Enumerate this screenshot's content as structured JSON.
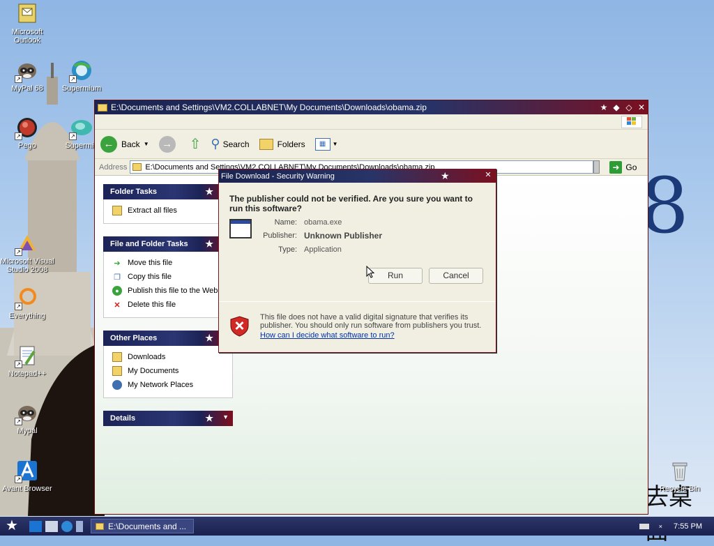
{
  "desktop": {
    "icons": [
      {
        "label": "Microsoft\nOutlook",
        "icon": "outlook-icon"
      },
      {
        "label": "MyPal 68",
        "icon": "raccoon-icon"
      },
      {
        "label": "Supermium",
        "icon": "supermium-icon"
      },
      {
        "label": "Pego",
        "icon": "pego-icon"
      },
      {
        "label": "Supermiu",
        "icon": "supermium-icon"
      },
      {
        "label": "Microsoft Visual Studio 2008",
        "icon": "visual-studio-icon"
      },
      {
        "label": "Everything",
        "icon": "everything-icon"
      },
      {
        "label": "Notepad++",
        "icon": "notepad-plus-plus-icon"
      },
      {
        "label": "Mypal",
        "icon": "raccoon-icon"
      },
      {
        "label": "Avant Browser",
        "icon": "avant-browser-icon"
      },
      {
        "label": "Recycle Bin",
        "icon": "recycle-bin-icon"
      }
    ],
    "wallpaper_text": {
      "numeral": "8",
      "chinese": "去桌面"
    }
  },
  "explorer": {
    "title": "E:\\Documents and Settings\\VM2.COLLABNET\\My Documents\\Downloads\\obama.zip",
    "toolbar": {
      "back": "Back",
      "search": "Search",
      "folders": "Folders"
    },
    "address": {
      "label": "Address",
      "value": "E:\\Documents and Settings\\VM2.COLLABNET\\My Documents\\Downloads\\obama.zip",
      "go": "Go"
    },
    "panes": {
      "folder_tasks": {
        "title": "Folder Tasks",
        "items": [
          "Extract all files"
        ]
      },
      "file_tasks": {
        "title": "File and Folder Tasks",
        "items": [
          "Move this file",
          "Copy this file",
          "Publish this file to the Web",
          "Delete this file"
        ]
      },
      "other_places": {
        "title": "Other Places",
        "items": [
          "Downloads",
          "My Documents",
          "My Network Places"
        ]
      },
      "details": {
        "title": "Details"
      }
    }
  },
  "dialog": {
    "title": "File Download - Security Warning",
    "question": "The publisher could not be verified.  Are you sure you want to run this software?",
    "name_label": "Name:",
    "name_value": "obama.exe",
    "publisher_label": "Publisher:",
    "publisher_value": "Unknown Publisher",
    "type_label": "Type:",
    "type_value": "Application",
    "run": "Run",
    "cancel": "Cancel",
    "warning": "This file does not have a valid digital signature that verifies its publisher.  You should only run software from publishers you trust.",
    "link": "How can I decide what software to run?"
  },
  "taskbar": {
    "task_label": "E:\\Documents and ...",
    "clock": "7:55 PM"
  },
  "colors": {
    "title_navy": "#1b2450",
    "title_red": "#7a1020",
    "link": "#0033aa"
  }
}
